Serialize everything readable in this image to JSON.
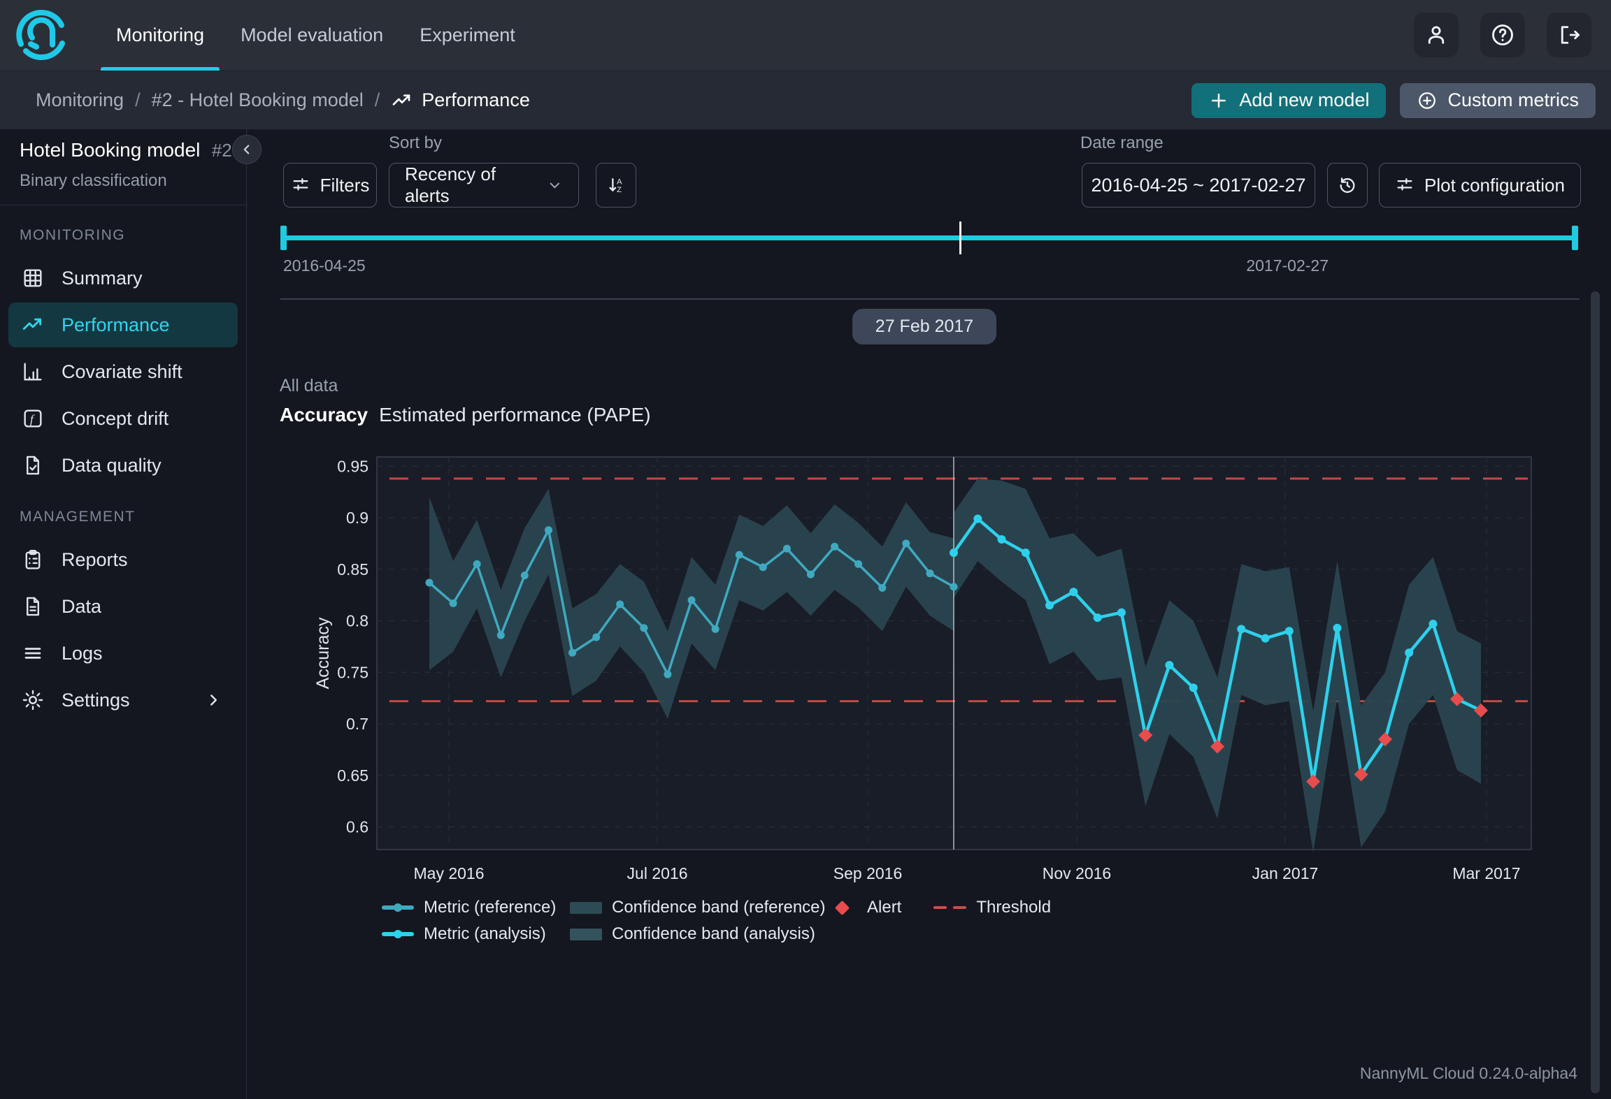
{
  "topnav": {
    "tabs": [
      {
        "label": "Monitoring",
        "active": true
      },
      {
        "label": "Model evaluation",
        "active": false
      },
      {
        "label": "Experiment",
        "active": false
      }
    ],
    "icon_buttons": [
      "user-icon",
      "help-icon",
      "logout-icon"
    ]
  },
  "breadcrumb": {
    "separator": "/",
    "items": [
      "Monitoring",
      "#2 - Hotel Booking model"
    ],
    "current": "Performance"
  },
  "header_actions": {
    "add_model_label": "Add new model",
    "custom_metrics_label": "Custom metrics"
  },
  "sidebar": {
    "model_name": "Hotel Booking model",
    "model_number": "#2",
    "model_type": "Binary classification",
    "sections": [
      {
        "title": "MONITORING",
        "items": [
          {
            "label": "Summary",
            "icon": "summary-grid-icon",
            "active": false
          },
          {
            "label": "Performance",
            "icon": "trend-up-icon",
            "active": true
          },
          {
            "label": "Covariate shift",
            "icon": "bar-chart-icon",
            "active": false
          },
          {
            "label": "Concept drift",
            "icon": "function-icon",
            "active": false
          },
          {
            "label": "Data quality",
            "icon": "doc-check-icon",
            "active": false
          }
        ]
      },
      {
        "title": "MANAGEMENT",
        "items": [
          {
            "label": "Reports",
            "icon": "clipboard-icon",
            "active": false
          },
          {
            "label": "Data",
            "icon": "document-icon",
            "active": false
          },
          {
            "label": "Logs",
            "icon": "lines-icon",
            "active": false
          },
          {
            "label": "Settings",
            "icon": "gear-icon",
            "active": false,
            "chevron": true
          }
        ]
      }
    ]
  },
  "toolbar": {
    "sort_by_label": "Sort by",
    "filters_label": "Filters",
    "sort_value": "Recency of alerts",
    "date_range_label": "Date range",
    "date_range_value": "2016-04-25 ~ 2017-02-27",
    "plot_config_label": "Plot configuration"
  },
  "timeline": {
    "start_date": "2016-04-25",
    "end_date": "2017-02-27",
    "cursor_label": "27 Feb 2017"
  },
  "chart_header": {
    "scope": "All data",
    "metric": "Accuracy",
    "subtitle": "Estimated performance (PAPE)"
  },
  "chart_data": {
    "type": "line",
    "title": "Accuracy — Estimated performance (PAPE)",
    "xlabel": "",
    "ylabel": "Accuracy",
    "ylim": [
      0.578,
      0.959
    ],
    "yticks": [
      0.6,
      0.65,
      0.7,
      0.75,
      0.8,
      0.85,
      0.9,
      0.95
    ],
    "xtick_labels": [
      "May 2016",
      "Jul 2016",
      "Sep 2016",
      "Nov 2016",
      "Jan 2017",
      "Mar 2017"
    ],
    "xtick_frac": [
      0.0624,
      0.2429,
      0.4252,
      0.6063,
      0.7868,
      0.9612
    ],
    "grid": true,
    "legend_position": "bottom",
    "thresholds": {
      "upper": 0.938,
      "lower": 0.722,
      "color": "#c44946"
    },
    "divider_frac": 0.4997,
    "alert_color": "#e84c4c",
    "series": [
      {
        "name": "Metric (reference)",
        "role": "reference",
        "color": "#3fa9c0",
        "x_frac": [
          0.0454,
          0.0661,
          0.0867,
          0.1074,
          0.128,
          0.1487,
          0.1693,
          0.19,
          0.2106,
          0.2313,
          0.2519,
          0.2726,
          0.2932,
          0.3139,
          0.3345,
          0.3552,
          0.3758,
          0.3965,
          0.4171,
          0.4378,
          0.4584,
          0.4791,
          0.4997
        ],
        "values": [
          0.837,
          0.817,
          0.855,
          0.786,
          0.844,
          0.888,
          0.769,
          0.784,
          0.816,
          0.793,
          0.748,
          0.82,
          0.792,
          0.864,
          0.852,
          0.87,
          0.845,
          0.872,
          0.855,
          0.832,
          0.875,
          0.846,
          0.833
        ],
        "band": {
          "name": "Confidence band (reference)",
          "color": "#2a4650",
          "upper": [
            0.92,
            0.858,
            0.898,
            0.83,
            0.89,
            0.928,
            0.812,
            0.826,
            0.855,
            0.838,
            0.79,
            0.862,
            0.835,
            0.903,
            0.892,
            0.912,
            0.885,
            0.913,
            0.895,
            0.872,
            0.915,
            0.886,
            0.88
          ],
          "lower": [
            0.752,
            0.77,
            0.812,
            0.745,
            0.8,
            0.845,
            0.727,
            0.742,
            0.775,
            0.75,
            0.705,
            0.778,
            0.752,
            0.82,
            0.81,
            0.828,
            0.805,
            0.83,
            0.813,
            0.79,
            0.833,
            0.805,
            0.79
          ]
        }
      },
      {
        "name": "Metric (analysis)",
        "role": "analysis",
        "color": "#2ed1ec",
        "x_frac": [
          0.4997,
          0.5205,
          0.5412,
          0.562,
          0.5827,
          0.6035,
          0.6243,
          0.645,
          0.6658,
          0.6865,
          0.7073,
          0.7281,
          0.7488,
          0.7696,
          0.7903,
          0.8111,
          0.8319,
          0.8526,
          0.8734,
          0.8941,
          0.9149,
          0.9357,
          0.9564
        ],
        "values": [
          0.866,
          0.899,
          0.879,
          0.866,
          0.815,
          0.828,
          0.803,
          0.808,
          0.689,
          0.757,
          0.735,
          0.678,
          0.792,
          0.783,
          0.79,
          0.644,
          0.793,
          0.651,
          0.685,
          0.769,
          0.797,
          0.724,
          0.713
        ],
        "alert_indices": [
          8,
          11,
          15,
          17,
          18,
          21,
          22
        ],
        "band": {
          "name": "Confidence band (analysis)",
          "color": "#2a4650",
          "upper": [
            0.905,
            0.938,
            0.936,
            0.928,
            0.88,
            0.885,
            0.862,
            0.87,
            0.755,
            0.82,
            0.8,
            0.745,
            0.855,
            0.848,
            0.852,
            0.712,
            0.858,
            0.718,
            0.75,
            0.835,
            0.862,
            0.79,
            0.778
          ],
          "lower": [
            0.822,
            0.858,
            0.838,
            0.82,
            0.758,
            0.77,
            0.742,
            0.745,
            0.62,
            0.69,
            0.668,
            0.608,
            0.728,
            0.718,
            0.722,
            0.575,
            0.725,
            0.58,
            0.615,
            0.7,
            0.728,
            0.655,
            0.642
          ]
        }
      }
    ]
  },
  "legend": {
    "rows": [
      [
        {
          "label": "Metric (reference)",
          "swatch": "line",
          "color": "#3fa9c0"
        },
        {
          "label": "Confidence band (reference)",
          "swatch": "band",
          "color": "#2d4b55"
        },
        {
          "label": "Alert",
          "swatch": "diamond",
          "color": "#e84c4c"
        },
        {
          "label": "Threshold",
          "swatch": "dashes",
          "color": "#c4504d"
        }
      ],
      [
        {
          "label": "Metric (analysis)",
          "swatch": "line",
          "color": "#2ed1ec"
        },
        {
          "label": "Confidence band (analysis)",
          "swatch": "band",
          "color": "#33525c"
        }
      ]
    ]
  },
  "footer": {
    "version": "NannyML Cloud 0.24.0-alpha4"
  }
}
